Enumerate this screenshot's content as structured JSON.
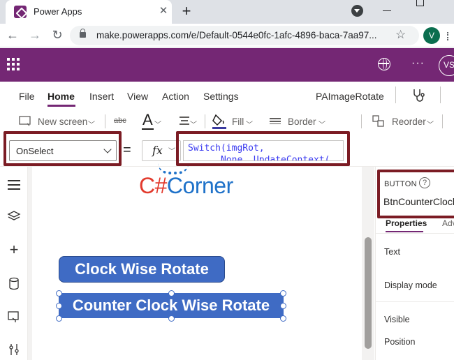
{
  "browser": {
    "tab_title": "Power Apps",
    "close_glyph": "✕",
    "new_tab_glyph": "+",
    "url": "make.powerapps.com/e/Default-0544e0fc-1afc-4896-baca-7aa97...",
    "profile_initial": "V"
  },
  "header": {
    "avatar_initials": "VS",
    "more_glyph": "···"
  },
  "menu": {
    "items": [
      "File",
      "Home",
      "Insert",
      "View",
      "Action",
      "Settings"
    ],
    "active": "Home",
    "app_name": "PAImageRotate"
  },
  "commands": {
    "new_screen": "New screen",
    "font_glyph": "A",
    "fill": "Fill",
    "border": "Border",
    "reorder": "Reorder"
  },
  "formula_bar": {
    "property": "OnSelect",
    "equals": "=",
    "fx": "fx",
    "line1": "Switch(imgRot,",
    "line2": "      None, UpdateContext("
  },
  "canvas": {
    "logo_c": "C#",
    "logo_rest": "Corner",
    "button_clockwise": "Clock Wise Rotate",
    "button_counter": "Counter Clock Wise Rotate"
  },
  "right_pane": {
    "control_type": "BUTTON",
    "control_name": "BtnCounterClock",
    "tab_properties": "Properties",
    "tab_advanced": "Adv",
    "rows": [
      "Text",
      "Display mode",
      "Visible",
      "Position"
    ]
  },
  "colors": {
    "brand": "#742774",
    "button": "#3f6bc4",
    "highlight": "#7b1c24"
  }
}
